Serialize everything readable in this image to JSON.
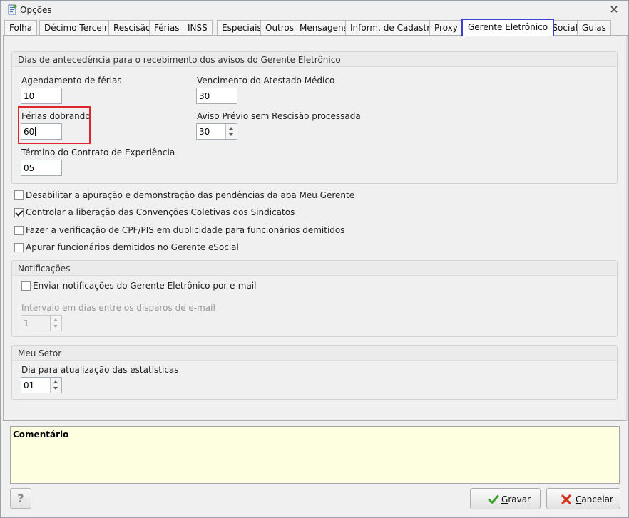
{
  "window": {
    "title": "Opções"
  },
  "tabs": [
    {
      "label": "Folha"
    },
    {
      "label": "Décimo Terceiro"
    },
    {
      "label": "Rescisão"
    },
    {
      "label": "Férias"
    },
    {
      "label": "INSS"
    },
    {
      "label": "Especiais"
    },
    {
      "label": "Outros"
    },
    {
      "label": "Mensagens"
    },
    {
      "label": "Inform. de Cadastro"
    },
    {
      "label": "Proxy"
    },
    {
      "label": "Gerente Eletrônico",
      "active": true
    },
    {
      "label": "eSocial"
    },
    {
      "label": "Guias"
    }
  ],
  "advance_group": {
    "title": "Dias de antecedência para o recebimento dos avisos do Gerente Eletrônico",
    "agendamento": {
      "label": "Agendamento de férias",
      "value": "10"
    },
    "ferias_dobrando": {
      "label": "Férias dobrando",
      "value": "60"
    },
    "termino_contrato": {
      "label": "Término do Contrato de Experiência",
      "value": "05"
    },
    "vencimento_atestado": {
      "label": "Vencimento do Atestado Médico",
      "value": "30"
    },
    "aviso_previo": {
      "label": "Aviso Prévio sem Rescisão processada",
      "value": "30"
    }
  },
  "options": [
    {
      "label": "Desabilitar a apuração e demonstração das pendências da aba Meu Gerente",
      "checked": false
    },
    {
      "label": "Controlar a liberação das Convenções Coletivas dos Sindicatos",
      "checked": true
    },
    {
      "label": "Fazer a verificação de CPF/PIS em duplicidade para funcionários demitidos",
      "checked": false
    },
    {
      "label": "Apurar funcionários demitidos no Gerente eSocial",
      "checked": false
    }
  ],
  "notificacoes": {
    "title": "Notificações",
    "enviar": {
      "label": "Enviar notificações do Gerente Eletrônico por e-mail",
      "checked": false
    },
    "intervalo": {
      "label": "Intervalo em dias entre os disparos de e-mail",
      "value": "1"
    }
  },
  "meu_setor": {
    "title": "Meu Setor",
    "dia": {
      "label": "Dia para atualização das estatísticas",
      "value": "01"
    }
  },
  "comentario": {
    "label": "Comentário"
  },
  "buttons": {
    "help": "?",
    "gravar_first": "G",
    "gravar_rest": "ravar",
    "cancelar_first": "C",
    "cancelar_rest": "ancelar"
  },
  "colors": {
    "active_tab_border": "#3f3fd6",
    "highlight": "#e0262a",
    "comment_bg": "#fefee0"
  },
  "icons": {
    "window": "options-window-icon",
    "close": "close-icon",
    "gravar": "green-check-icon",
    "cancelar": "red-x-icon"
  }
}
